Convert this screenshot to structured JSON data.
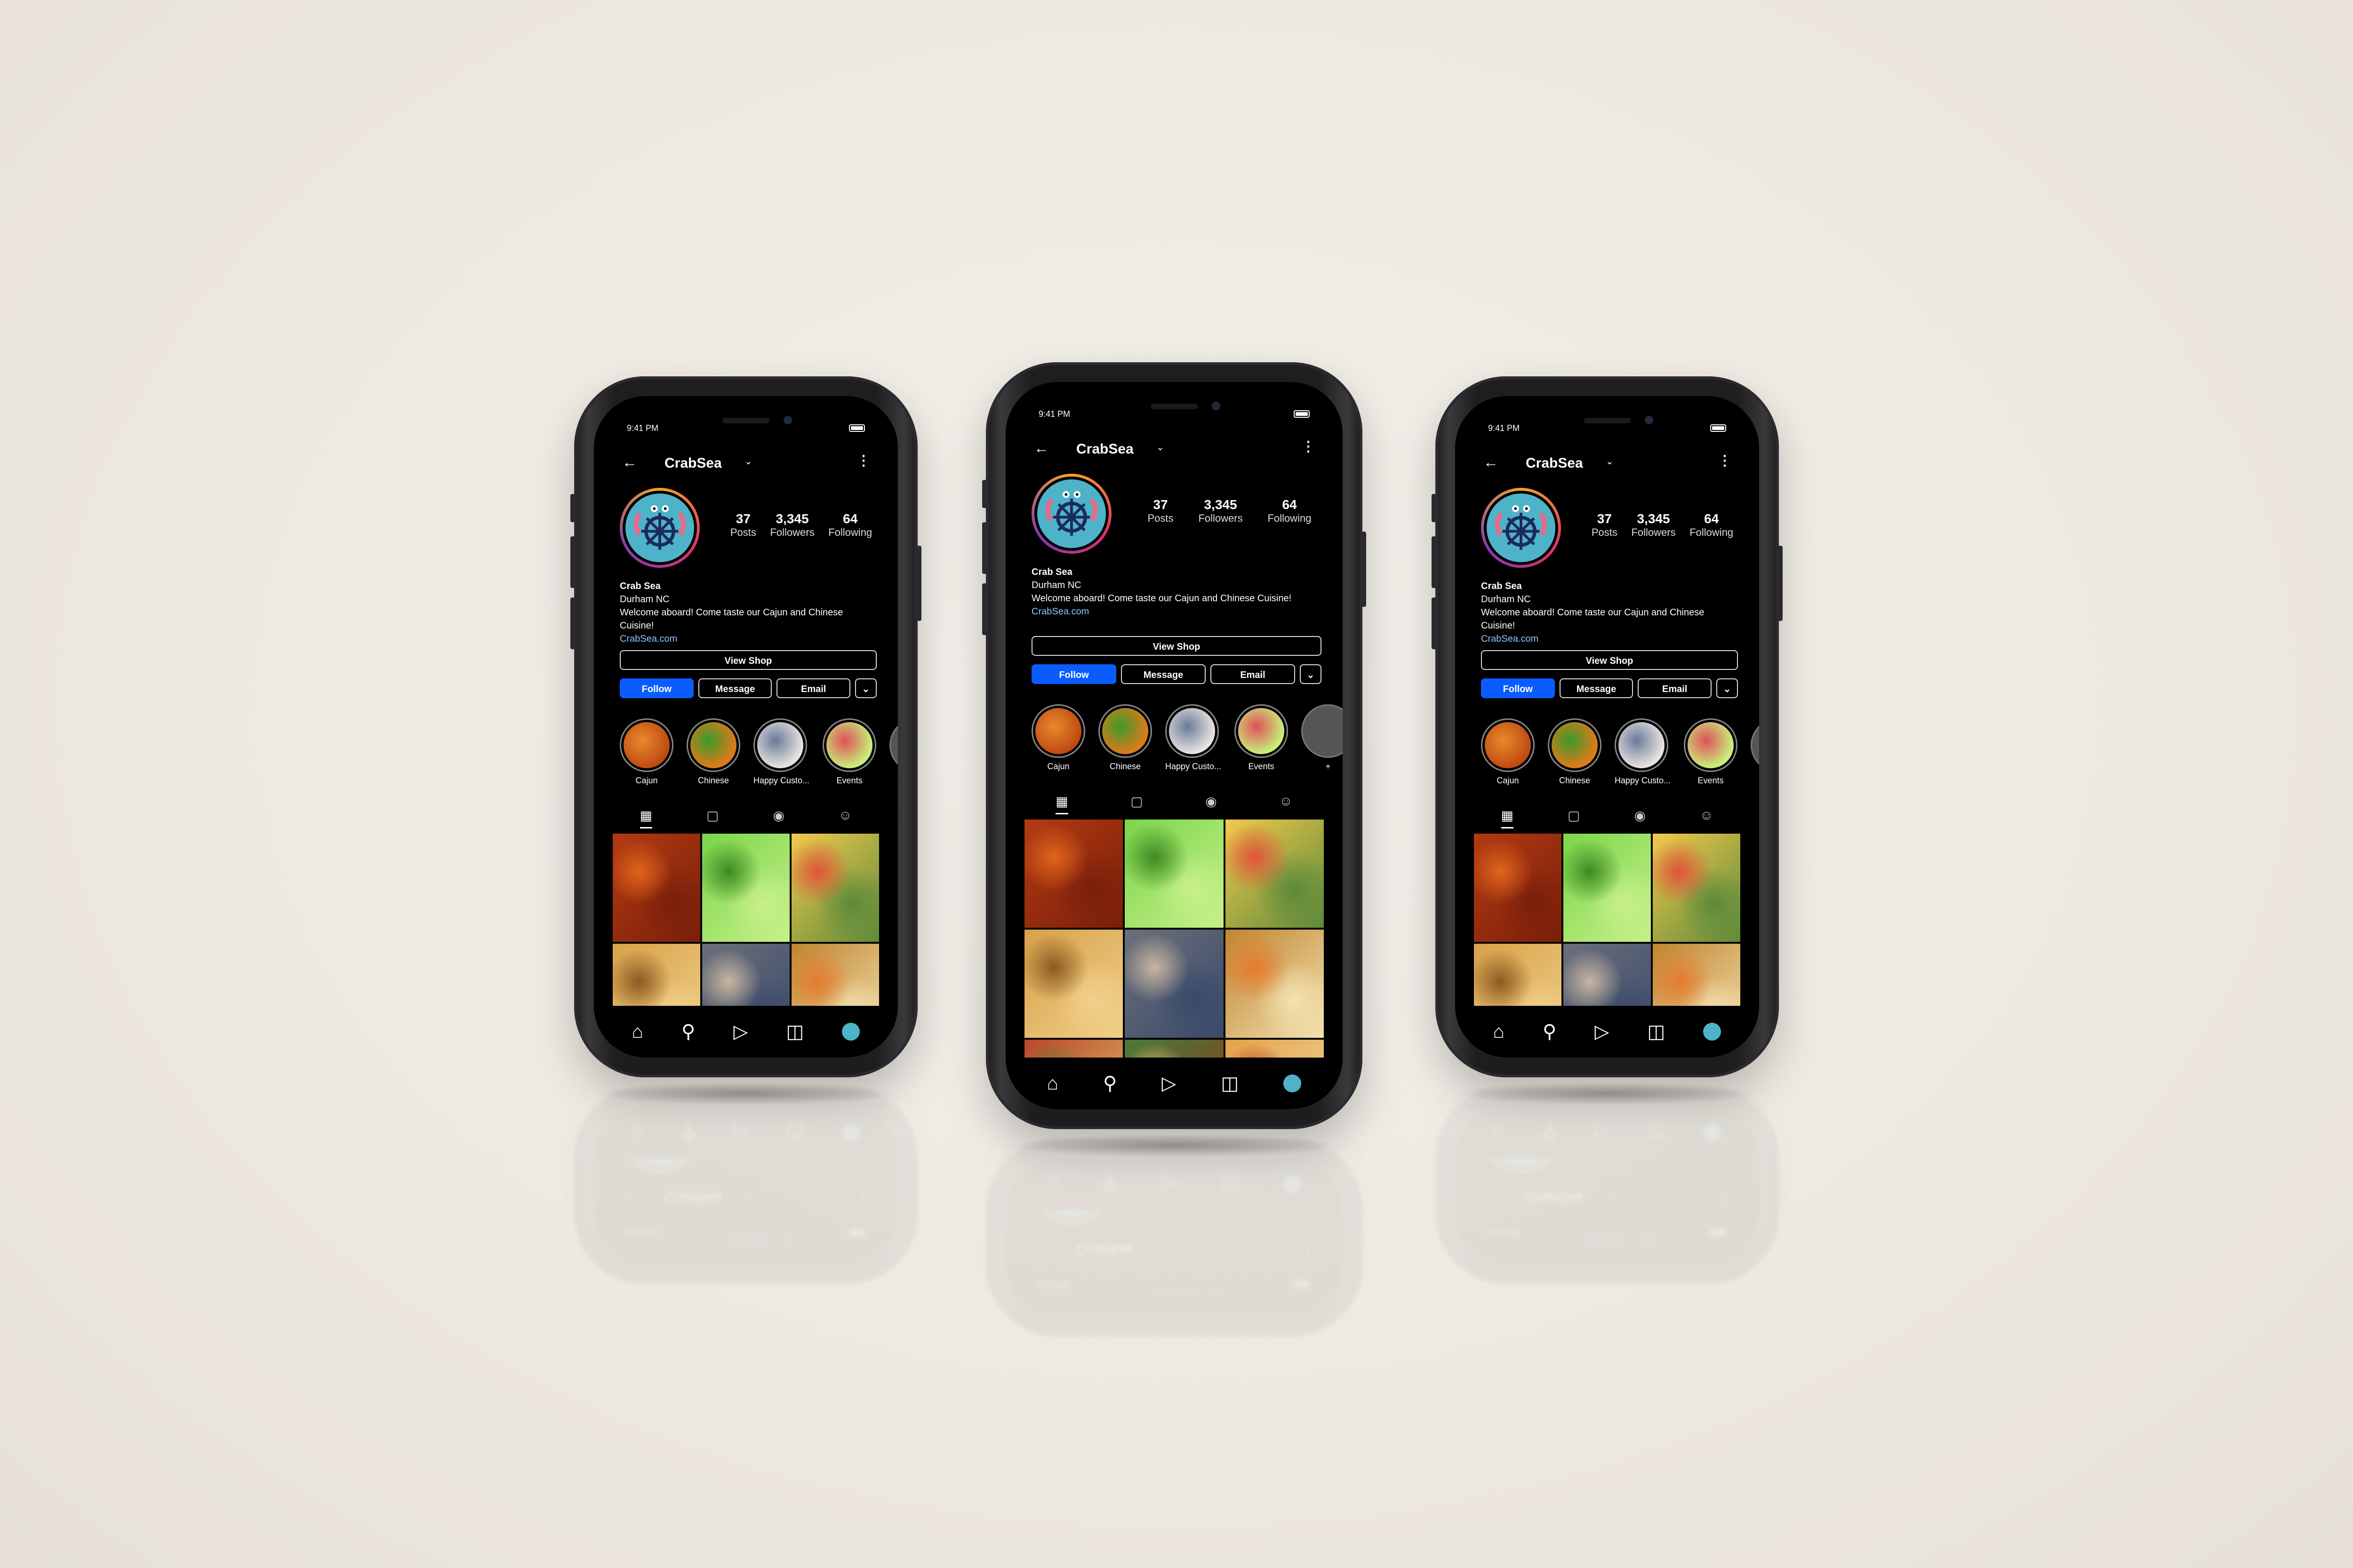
{
  "phones": [
    {
      "status_time": "9:41 PM",
      "handle": "CrabSea",
      "stats": [
        {
          "n": "37",
          "l": "Posts"
        },
        {
          "n": "3,345",
          "l": "Followers"
        },
        {
          "n": "64",
          "l": "Following"
        }
      ],
      "bio": {
        "name": "Crab Sea",
        "location": "Durham NC",
        "text": "Welcome aboard! Come taste our Cajun and Chinese Cuisine!",
        "link": "CrabSea.com"
      },
      "buttons": {
        "shop": "View Shop",
        "follow": "Follow",
        "message": "Message",
        "email": "Email"
      },
      "highlights": [
        "Cajun",
        "Chinese",
        "Happy Custo...",
        "Events"
      ]
    }
  ],
  "colors": {
    "accent": "#0a5cff",
    "avatar_bg": "#4eb3c8",
    "link": "#8ec5ff",
    "background": "#ede8e1"
  },
  "icons": {
    "back": "back-arrow-icon",
    "more": "more-dots-icon",
    "grid": "grid-icon",
    "reels": "reels-icon",
    "location": "location-pin-icon",
    "tagged": "tagged-icon",
    "home": "home-icon",
    "search": "search-icon",
    "shop": "shop-bag-icon"
  }
}
